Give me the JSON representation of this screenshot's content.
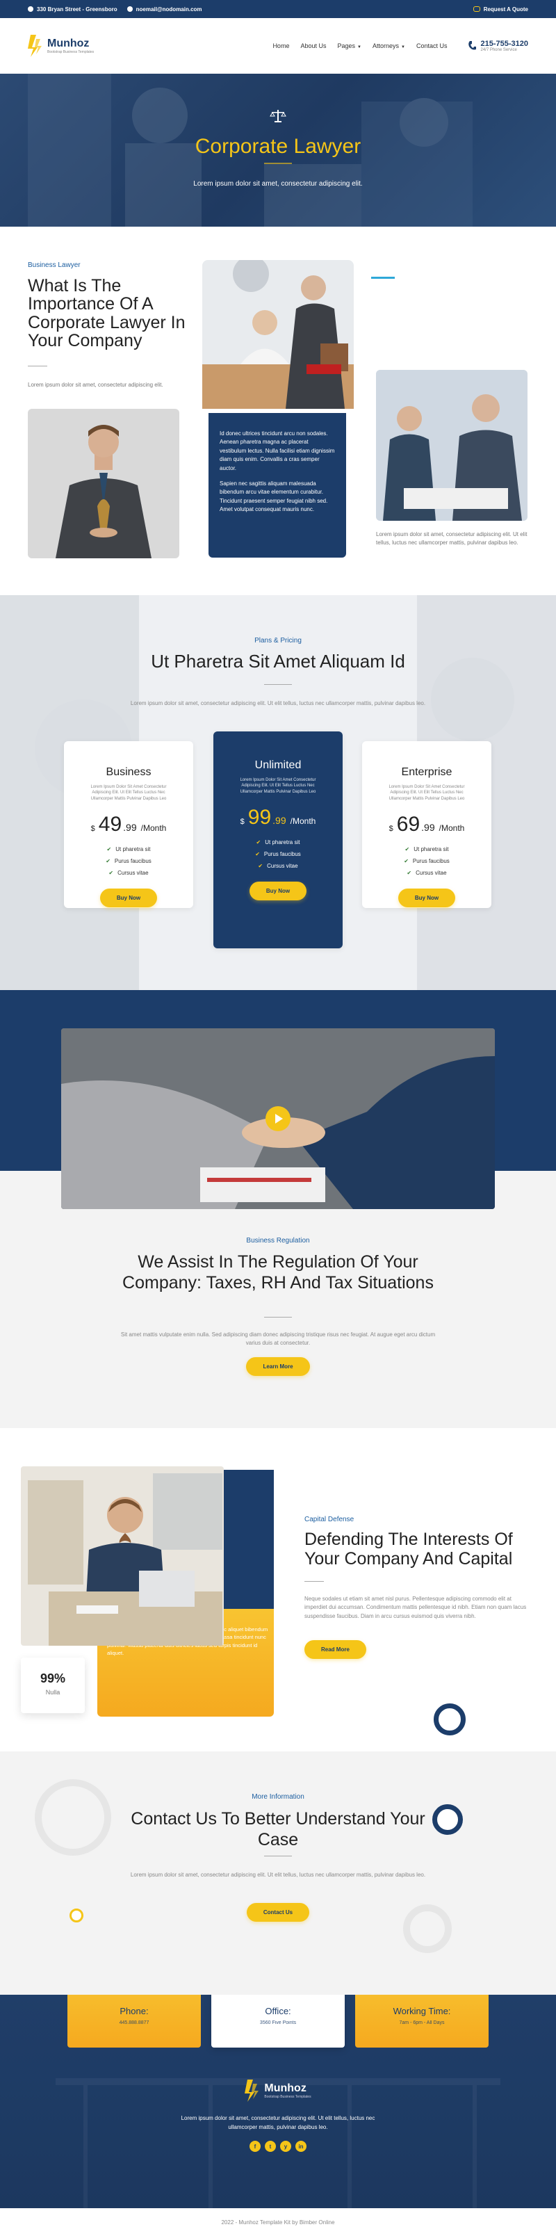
{
  "topbar": {
    "address": "330 Bryan Street - Greensboro",
    "email": "noemail@nodomain.com",
    "quote": "Request A Quote"
  },
  "header": {
    "logo_name": "Munhoz",
    "logo_sub": "Bootstrap Business Templates",
    "nav": [
      "Home",
      "About Us",
      "Pages",
      "Attorneys",
      "Contact Us"
    ],
    "phone": "215-755-3120",
    "phone_sub": "24/7 Phone Service"
  },
  "hero": {
    "title": "Corporate Lawyer",
    "subtitle": "Lorem ipsum dolor sit amet, consectetur adipiscing elit."
  },
  "about": {
    "eyebrow": "Business Lawyer",
    "title": "What Is The Importance Of A Corporate Lawyer In Your Company",
    "lead": "Lorem ipsum dolor sit amet, consectetur adipiscing elit.",
    "box_p1": "Id donec ultrices tincidunt arcu non sodales. Aenean pharetra magna ac placerat vestibulum lectus. Nulla facilisi etiam dignissim diam quis enim. Convallis a cras semper auctor.",
    "box_p2": "Sapien nec sagittis aliquam malesuada bibendum arcu vitae elementum curabitur. Tincidunt praesent semper feugiat nibh sed. Amet volutpat consequat mauris nunc.",
    "side": "Lorem ipsum dolor sit amet, consectetur adipiscing elit. Ut elit tellus, luctus nec ullamcorper mattis, pulvinar dapibus leo."
  },
  "pricing": {
    "eyebrow": "Plans & Pricing",
    "title": "Ut Pharetra Sit Amet Aliquam Id",
    "lead": "Lorem ipsum dolor sit amet, consectetur adipiscing elit. Ut elit tellus, luctus nec ullamcorper mattis, pulvinar dapibus leo.",
    "plans": [
      {
        "name": "Business",
        "desc": "Lorem Ipsum Dolor Sit Amet Consectetur Adipiscing Elit. Ut Elit Tellus Luctus Nec Ullamcorper Mattis Pulvinar Dapibus Leo",
        "currency": "$",
        "whole": "49",
        "cents": ".99",
        "per": "/Month",
        "features": [
          "Ut pharetra sit",
          "Purus faucibus",
          "Cursus vitae"
        ],
        "button": "Buy Now"
      },
      {
        "name": "Unlimited",
        "desc": "Lorem Ipsum Dolor Sit Amet Consectetur Adipiscing Elit. Ut Elit Tellus Luctus Nec Ullamcorper Mattis Pulvinar Dapibus Leo",
        "currency": "$",
        "whole": "99",
        "cents": ".99",
        "per": "/Month",
        "features": [
          "Ut pharetra sit",
          "Purus faucibus",
          "Cursus vitae"
        ],
        "button": "Buy Now"
      },
      {
        "name": "Enterprise",
        "desc": "Lorem Ipsum Dolor Sit Amet Consectetur Adipiscing Elit. Ut Elit Tellus Luctus Nec Ullamcorper Mattis Pulvinar Dapibus Leo",
        "currency": "$",
        "whole": "69",
        "cents": ".99",
        "per": "/Month",
        "features": [
          "Ut pharetra sit",
          "Purus faucibus",
          "Cursus vitae"
        ],
        "button": "Buy Now"
      }
    ]
  },
  "regulation": {
    "eyebrow": "Business Regulation",
    "title": "We Assist In The Regulation Of Your Company: Taxes, RH And Tax Situations",
    "lead": "Sit amet mattis vulputate enim nulla. Sed adipiscing diam donec adipiscing tristique risus nec feugiat. At augue eget arcu dictum varius duis at consectetur.",
    "button": "Learn More"
  },
  "defense": {
    "eyebrow": "Capital Defense",
    "title": "Defending The Interests Of Your Company And Capital",
    "lead": "Neque sodales ut etiam sit amet nisl purus. Pellentesque adipiscing commodo elit at imperdiet dui accumsan. Condimentum mattis pellentesque id nibh. Etiam non quam lacus suspendisse faucibus. Diam in arcu cursus euismod quis viverra nibh.",
    "button": "Read More",
    "stat_num": "99%",
    "stat_label": "Nulla",
    "box_text": "Proin gravida hendrerit lectus a. Viverra ipsum nunc aliquet bibendum enim. Sit amet mauris commodo quis imperdiet massa tincidunt nunc pulvinar. Massa placerat duis ultricies lacus sed turpis tincidunt id aliquet."
  },
  "contact": {
    "eyebrow": "More Information",
    "title": "Contact Us To Better Understand Your Case",
    "lead": "Lorem ipsum dolor sit amet, consectetur adipiscing elit. Ut elit tellus, luctus nec ullamcorper mattis, pulvinar dapibus leo.",
    "button": "Contact Us"
  },
  "info": [
    {
      "title": "Phone:",
      "sub": "445.888.8877",
      "icon": "phone-icon"
    },
    {
      "title": "Office:",
      "sub": "3560 Five Points",
      "icon": "location-icon"
    },
    {
      "title": "Working Time:",
      "sub": "7am - 6pm - All Days",
      "icon": "globe-icon"
    }
  ],
  "footer": {
    "logo_name": "Munhoz",
    "logo_sub": "Bootstrap Business Templates",
    "text": "Lorem ipsum dolor sit amet, consectetur adipiscing elit. Ut elit tellus, luctus nec ullamcorper mattis, pulvinar dapibus leo.",
    "socials": [
      "f",
      "t",
      "y",
      "in"
    ],
    "copyright": "2022 - Munhoz Template Kit by Bimber Online"
  },
  "colors": {
    "navy": "#1c3d6a",
    "yellow": "#f5c518"
  }
}
